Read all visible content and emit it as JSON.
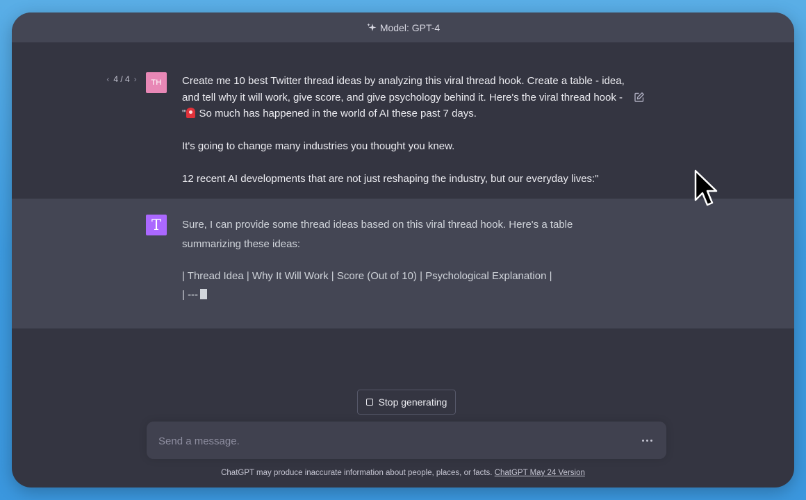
{
  "header": {
    "model_label": "Model: GPT-4",
    "icon": "sparkle-icon"
  },
  "user_message": {
    "pager": "4 / 4",
    "avatar_initials": "TH",
    "avatar_color": "#e888b6",
    "line1_before_emoji": "Create me 10 best Twitter thread ideas by analyzing this viral thread hook. Create a table - idea, and tell why it will work, give score, and give psychology behind it. Here's the viral thread hook - \"",
    "emoji": "siren-emoji",
    "line1_after_emoji": " So much has happened in the world of AI these past 7 days.",
    "line2": "It's going to change many industries you thought you knew.",
    "line3": "12 recent AI developments that are not just reshaping the industry, but our everyday lives:\""
  },
  "assistant_message": {
    "avatar_letter": "T",
    "avatar_color": "#ab68ff",
    "intro": "Sure, I can provide some thread ideas based on this viral thread hook. Here's a table summarizing these ideas:",
    "table_header": "| Thread Idea | Why It Will Work | Score (Out of 10) | Psychological Explanation |",
    "table_partial": "| ---"
  },
  "controls": {
    "stop_label": "Stop generating",
    "input_placeholder": "Send a message."
  },
  "footer": {
    "disclaimer": "ChatGPT may produce inaccurate information about people, places, or facts.",
    "version_link": "ChatGPT May 24 Version"
  },
  "colors": {
    "background_blue": "#4aa3e4",
    "chat_bg": "#343541",
    "assistant_bg": "#444654"
  }
}
